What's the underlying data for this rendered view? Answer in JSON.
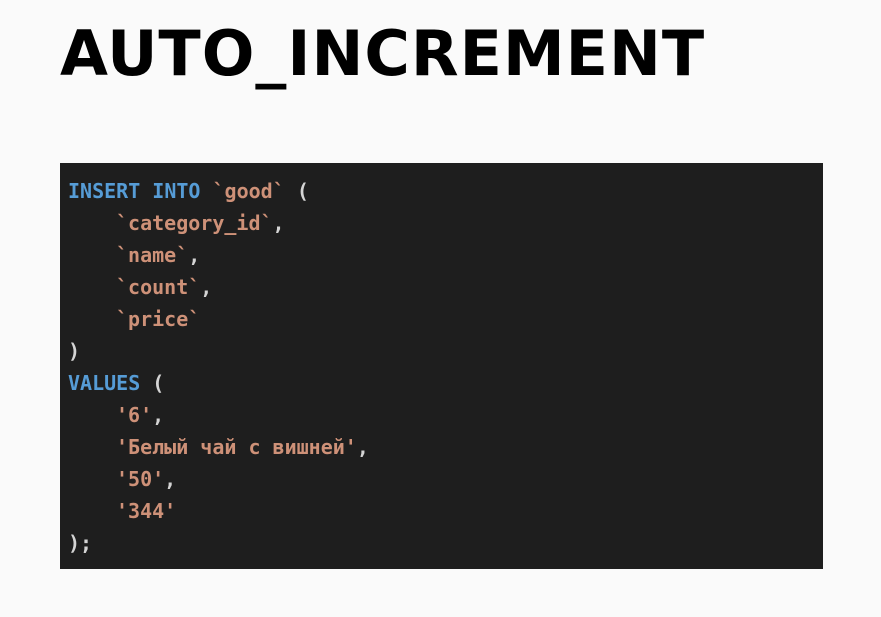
{
  "title": "AUTO_INCREMENT",
  "code": {
    "keyword_insert": "INSERT",
    "keyword_into": "INTO",
    "table": "`good`",
    "open_paren": "(",
    "columns": [
      "`category_id`",
      "`name`",
      "`count`",
      "`price`"
    ],
    "close_paren": ")",
    "keyword_values": "VALUES",
    "values": [
      "'6'",
      "'Белый чай с вишней'",
      "'50'",
      "'344'"
    ],
    "end": ");",
    "comma": ","
  },
  "colors": {
    "keyword": "#569cd6",
    "string": "#ce9178",
    "punctuation": "#d4d4d4",
    "code_background": "#1e1e1e",
    "page_background": "#fafafa"
  }
}
